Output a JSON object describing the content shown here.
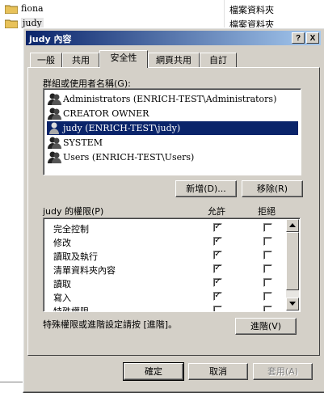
{
  "background_list": {
    "rows": [
      {
        "name": "fiona",
        "type": "檔案資料夾"
      },
      {
        "name": "judy",
        "type": "檔案資料夾"
      }
    ]
  },
  "dialog": {
    "title": "judy 內容",
    "help_label": "?",
    "close_label": "X",
    "tabs": [
      {
        "label": "一般"
      },
      {
        "label": "共用"
      },
      {
        "label": "安全性"
      },
      {
        "label": "網頁共用"
      },
      {
        "label": "自訂"
      }
    ],
    "security": {
      "groups_label": "群組或使用者名稱(G):",
      "users": [
        {
          "name": "Administrators (ENRICH-TEST\\Administrators)"
        },
        {
          "name": "CREATOR OWNER"
        },
        {
          "name": "judy (ENRICH-TEST\\judy)"
        },
        {
          "name": "SYSTEM"
        },
        {
          "name": "Users (ENRICH-TEST\\Users)"
        }
      ],
      "add_button": "新增(D)...",
      "remove_button": "移除(R)",
      "permissions_label": "judy 的權限(P)",
      "allow_header": "允許",
      "deny_header": "拒絕",
      "permissions": [
        {
          "name": "完全控制",
          "allow": "✓",
          "deny": ""
        },
        {
          "name": "修改",
          "allow": "✓",
          "deny": ""
        },
        {
          "name": "讀取及執行",
          "allow": "✓",
          "deny": ""
        },
        {
          "name": "清單資料夾內容",
          "allow": "✓",
          "deny": ""
        },
        {
          "name": "讀取",
          "allow": "✓",
          "deny": ""
        },
        {
          "name": "寫入",
          "allow": "✓",
          "deny": ""
        },
        {
          "name": "特殊權限",
          "allow": "",
          "deny": ""
        }
      ],
      "advanced_hint": "特殊權限或進階設定請按 [進階]。",
      "advanced_button": "進階(V)"
    },
    "ok_button": "確定",
    "cancel_button": "取消",
    "apply_button": "套用(A)"
  }
}
